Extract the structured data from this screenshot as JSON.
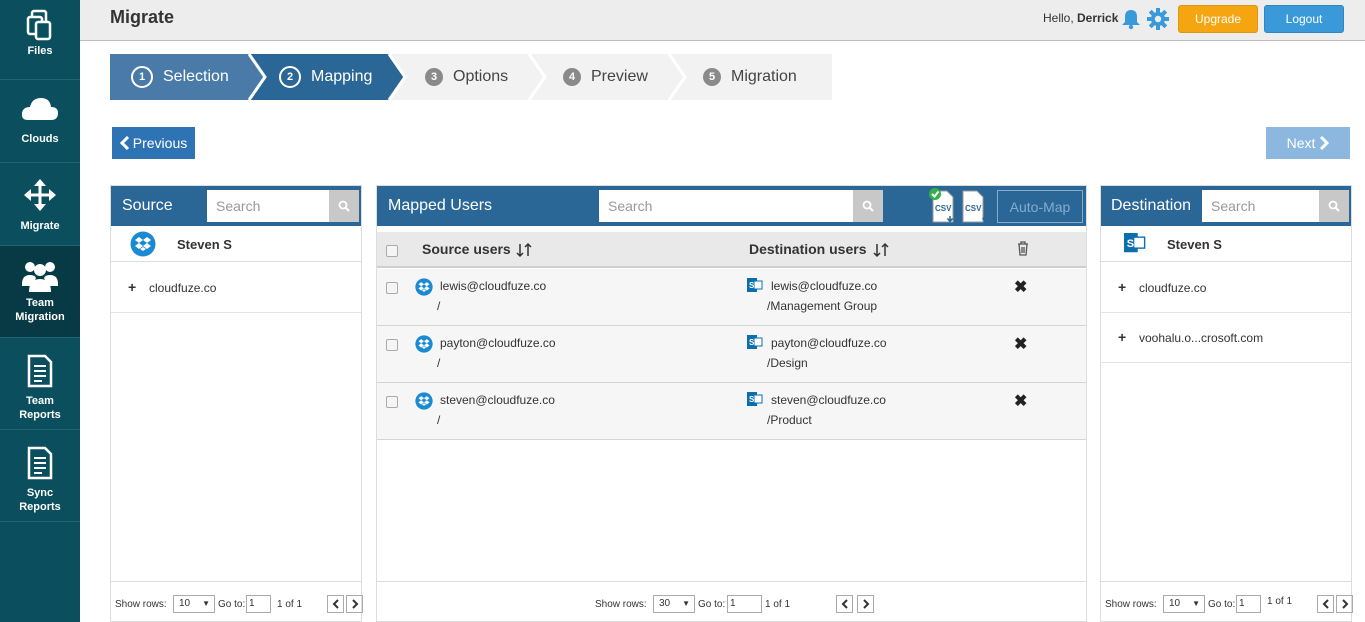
{
  "sidebar": {
    "items": [
      {
        "label": "Files",
        "icon": "files-icon"
      },
      {
        "label": "Clouds",
        "icon": "cloud-icon"
      },
      {
        "label": "Migrate",
        "icon": "move-arrows-icon"
      },
      {
        "label_line1": "Team",
        "label_line2": "Migration",
        "icon": "team-icon",
        "active": true
      },
      {
        "label_line1": "Team",
        "label_line2": "Reports",
        "icon": "report-icon"
      },
      {
        "label_line1": "Sync",
        "label_line2": "Reports",
        "icon": "report-icon"
      }
    ]
  },
  "header": {
    "title": "Migrate",
    "greeting": "Hello, ",
    "username": "Derrick",
    "upgrade_label": "Upgrade",
    "logout_label": "Logout"
  },
  "steps": [
    {
      "num": "1",
      "label": "Selection",
      "state": "done"
    },
    {
      "num": "2",
      "label": "Mapping",
      "state": "current"
    },
    {
      "num": "3",
      "label": "Options",
      "state": "todo"
    },
    {
      "num": "4",
      "label": "Preview",
      "state": "todo"
    },
    {
      "num": "5",
      "label": "Migration",
      "state": "todo"
    }
  ],
  "nav": {
    "previous_label": "Previous",
    "next_label": "Next"
  },
  "source": {
    "title": "Source",
    "search_placeholder": "Search",
    "user": "Steven S",
    "folders": [
      "cloudfuze.co"
    ],
    "footer": {
      "show_rows_label": "Show rows:",
      "rows": "10",
      "goto_label": "Go to:",
      "page": "1",
      "of": "1 of 1"
    }
  },
  "mapped": {
    "title": "Mapped Users",
    "search_placeholder": "Search",
    "automap_label": "Auto-Map",
    "csv_label": "CSV",
    "col_source": "Source users",
    "col_dest": "Destination users",
    "rows": [
      {
        "src": "lewis@cloudfuze.co",
        "src_path": "/",
        "dst": "lewis@cloudfuze.co",
        "dst_path": "/Management Group"
      },
      {
        "src": "payton@cloudfuze.co",
        "src_path": "/",
        "dst": "payton@cloudfuze.co",
        "dst_path": "/Design"
      },
      {
        "src": "steven@cloudfuze.co",
        "src_path": "/",
        "dst": "steven@cloudfuze.co",
        "dst_path": "/Product"
      }
    ],
    "footer": {
      "show_rows_label": "Show rows:",
      "rows": "30",
      "goto_label": "Go to:",
      "page": "1",
      "of": "1 of 1"
    }
  },
  "destination": {
    "title": "Destination",
    "search_placeholder": "Search",
    "user": "Steven S",
    "folders": [
      "cloudfuze.co",
      "voohalu.o...crosoft.com"
    ],
    "footer": {
      "show_rows_label": "Show rows:",
      "rows": "10",
      "goto_label": "Go to:",
      "page": "1",
      "of": "1 of 1"
    }
  },
  "colors": {
    "sidebar": "#0b4f5e",
    "panel_header": "#2a6797",
    "step_done": "#4a7ba8",
    "step_current": "#2a6797",
    "upgrade": "#f5a510",
    "logout": "#3a9ad9",
    "dropbox": "#1b8ad3",
    "sharepoint": "#0b6fae"
  }
}
